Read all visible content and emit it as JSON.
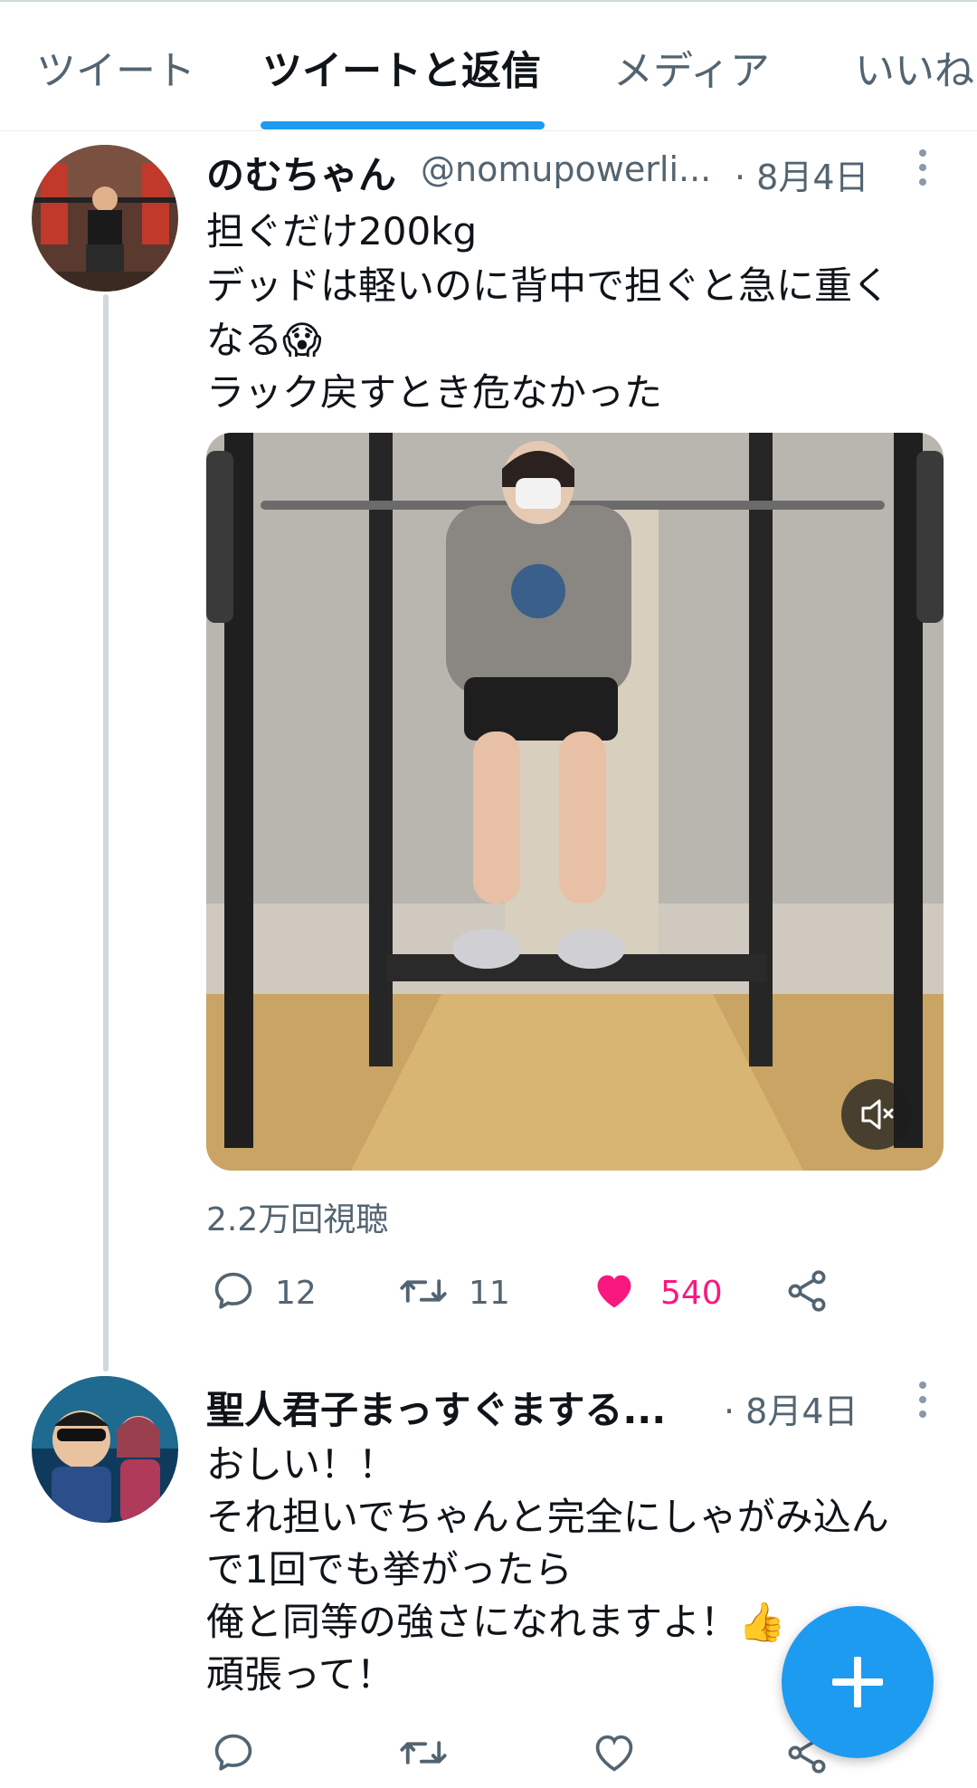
{
  "tabs": [
    {
      "label": "ツイート"
    },
    {
      "label": "ツイートと返信"
    },
    {
      "label": "メディア"
    },
    {
      "label": "いいね"
    }
  ],
  "tweet": {
    "display_name": "のむちゃん",
    "handle": "@nomupowerli...",
    "date": "· 8月4日",
    "text_lines": [
      "担ぐだけ200kg",
      "デッドは軽いのに背中で担ぐと急に重く",
      "なる😱",
      " ラック戻すとき危なかった"
    ],
    "views": "2.2万回視聴",
    "reply_count": "12",
    "retweet_count": "11",
    "like_count": "540",
    "liked": true
  },
  "reply": {
    "display_name": "聖人君子まっすぐまする...",
    "date": "· 8月4日",
    "text_lines": [
      "おしい！！",
      "それ担いでちゃんと完全にしゃがみ込ん",
      "で1回でも挙がったら",
      "俺と同等の強さになれますよ！👍",
      "頑張って！"
    ]
  },
  "colors": {
    "accent": "#1d9bf0",
    "like": "#f91880",
    "secondary_text": "#536471"
  },
  "icons": {
    "reply": "reply-icon",
    "retweet": "retweet-icon",
    "like": "heart-icon",
    "share": "share-icon",
    "mute": "mute-icon",
    "compose": "plus-icon"
  }
}
